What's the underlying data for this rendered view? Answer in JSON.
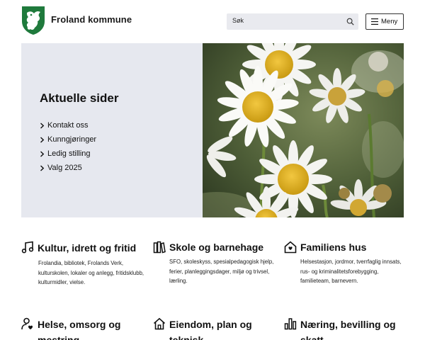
{
  "header": {
    "site_name": "Froland kommune",
    "search_placeholder": "Søk",
    "menu_label": "Meny",
    "brand_color": "#1f7a3c"
  },
  "hero": {
    "title": "Aktuelle sider",
    "links": [
      {
        "label": "Kontakt oss"
      },
      {
        "label": "Kunngjøringer"
      },
      {
        "label": "Ledig stilling"
      },
      {
        "label": "Valg 2025"
      }
    ],
    "image_icon": "daisy-flowers-photo"
  },
  "categories": [
    {
      "title": "Kultur, idrett og fritid",
      "icon": "music-note-icon",
      "description": "Frolandia, bibliotek, Frolands Verk, kulturskolen, lokaler og anlegg, fritidsklubb, kulturmidler, vielse."
    },
    {
      "title": "Skole og barnehage",
      "icon": "books-icon",
      "description": "SFO, skoleskyss, spesialpedagogisk hjelp, ferier, planleggingsdager, miljø og trivsel, lærling."
    },
    {
      "title": "Familiens hus",
      "icon": "house-heart-icon",
      "description": "Helsestasjon, jordmor, tverrfaglig innsats, rus- og kriminalitetsforebygging, familieteam, barnevern."
    },
    {
      "title": "Helse, omsorg og mestring",
      "icon": "person-heart-icon",
      "description": ""
    },
    {
      "title": "Eiendom, plan og teknisk",
      "icon": "house-icon",
      "description": ""
    },
    {
      "title": "Næring, bevilling og skatt",
      "icon": "bar-chart-icon",
      "description": ""
    }
  ]
}
